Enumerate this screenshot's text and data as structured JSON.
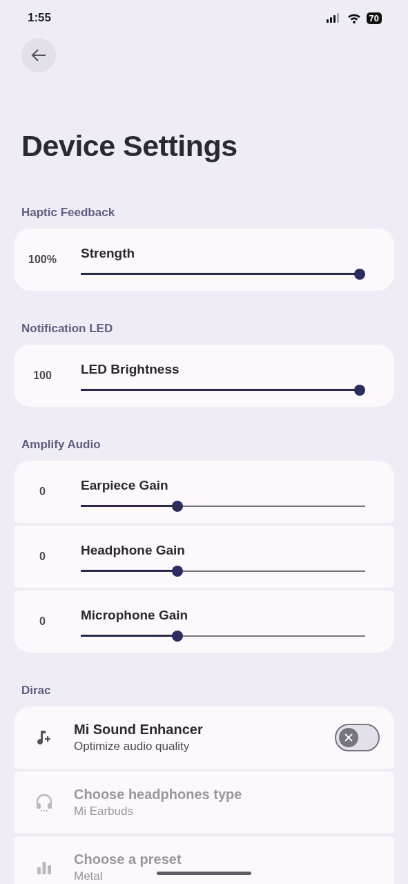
{
  "status_bar": {
    "time": "1:55",
    "battery": "70"
  },
  "title": "Device Settings",
  "sections": [
    {
      "title": "Haptic Feedback",
      "rows": [
        {
          "kind": "slider",
          "reading": "100%",
          "label": "Strength",
          "level": 1.0
        }
      ]
    },
    {
      "title": "Notification LED",
      "rows": [
        {
          "kind": "slider",
          "reading": "100",
          "label": "LED Brightness",
          "level": 1.0
        }
      ]
    },
    {
      "title": "Amplify Audio",
      "rows": [
        {
          "kind": "slider",
          "reading": "0",
          "label": "Earpiece Gain",
          "level": 0.333
        },
        {
          "kind": "slider",
          "reading": "0",
          "label": "Headphone Gain",
          "level": 0.333
        },
        {
          "kind": "slider",
          "reading": "0",
          "label": "Microphone Gain",
          "level": 0.333
        }
      ]
    },
    {
      "title": "Dirac",
      "rows": [
        {
          "kind": "switch",
          "title": "Mi Sound Enhancer",
          "subtitle": "Optimize audio quality",
          "on": false,
          "disabled": false
        },
        {
          "kind": "option",
          "title": "Choose headphones type",
          "subtitle": "Mi Earbuds",
          "disabled": true
        },
        {
          "kind": "option",
          "title": "Choose a preset",
          "subtitle": "Metal",
          "disabled": true
        }
      ]
    }
  ]
}
